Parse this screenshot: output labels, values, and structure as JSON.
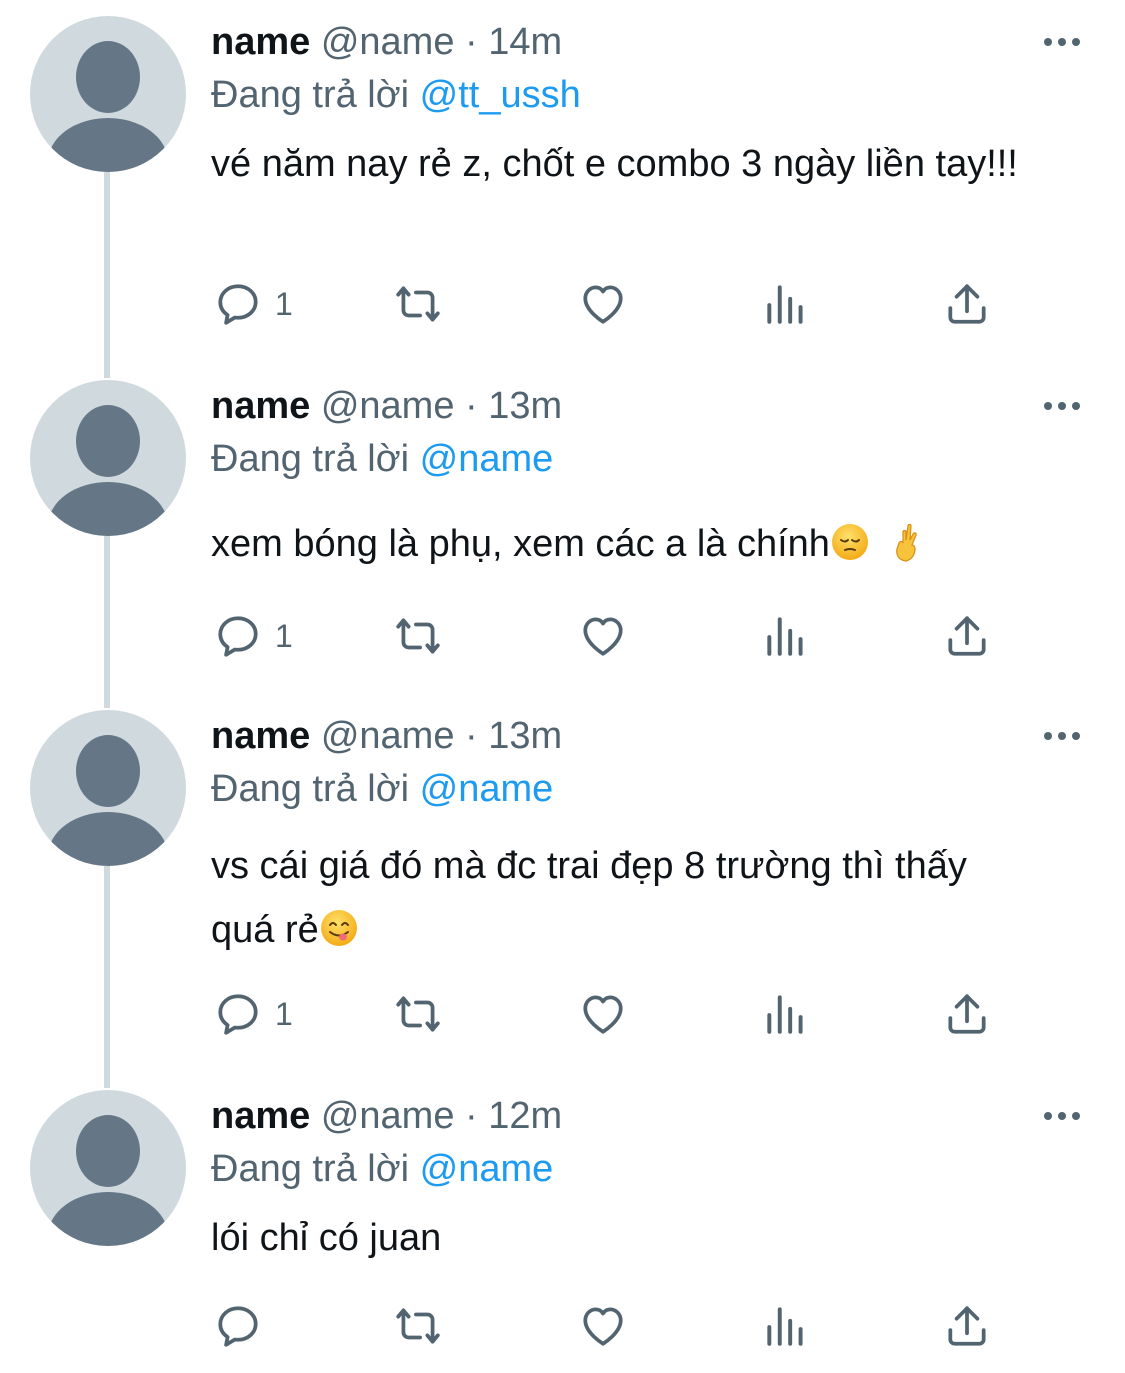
{
  "colors": {
    "avatar_bg": "#cfd9de",
    "avatar_fg": "#657786",
    "text_primary": "#0f1419",
    "text_secondary": "#536471",
    "link": "#1d9bf0",
    "thread_line": "#cfd9de"
  },
  "tweets": [
    {
      "display_name": "name",
      "handle": "@name",
      "separator": "·",
      "time": "14m",
      "replying_prefix": "Đang trả lời",
      "replying_to": "@tt_ussh",
      "text": "vé năm nay rẻ z, chốt e combo 3 ngày liền tay!!!",
      "emojis": [],
      "reply_count": "1"
    },
    {
      "display_name": "name",
      "handle": "@name",
      "separator": "·",
      "time": "13m",
      "replying_prefix": "Đang trả lời",
      "replying_to": "@name",
      "text": "xem bóng là phụ, xem các a là chính",
      "emojis": [
        "pensive-face-emoji",
        "crossed-fingers-emoji"
      ],
      "reply_count": "1"
    },
    {
      "display_name": "name",
      "handle": "@name",
      "separator": "·",
      "time": "13m",
      "replying_prefix": "Đang trả lời",
      "replying_to": "@name",
      "text": "vs cái giá đó mà đc trai đẹp 8 trường thì thấy quá rẻ",
      "emojis": [
        "yummy-face-emoji"
      ],
      "reply_count": "1"
    },
    {
      "display_name": "name",
      "handle": "@name",
      "separator": "·",
      "time": "12m",
      "replying_prefix": "Đang trả lời",
      "replying_to": "@name",
      "text": "lói chỉ có juan",
      "emojis": [],
      "reply_count": ""
    }
  ],
  "action_icons": [
    "reply-icon",
    "retweet-icon",
    "like-icon",
    "views-icon",
    "share-icon"
  ],
  "more_icon": "more-icon"
}
